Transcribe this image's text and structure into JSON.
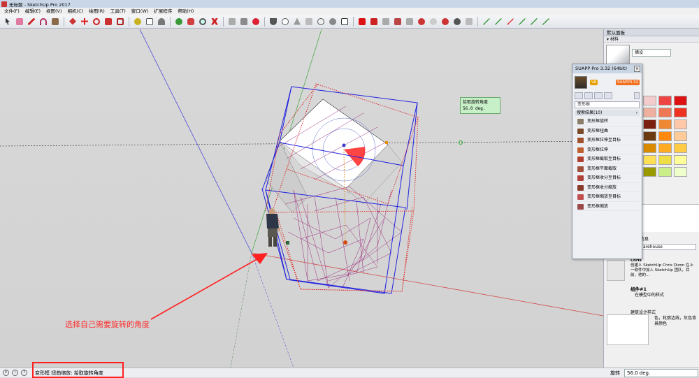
{
  "window": {
    "title": "无标题 - SketchUp Pro 2017"
  },
  "menu": [
    "文件(F)",
    "编辑(E)",
    "视图(V)",
    "相机(C)",
    "绘图(R)",
    "工具(T)",
    "窗口(W)",
    "扩展程序",
    "帮助(H)"
  ],
  "toolbar_icons": [
    "select-icon",
    "eraser-icon",
    "pencil-icon",
    "arc-icon",
    "shape-icon",
    "push-pull-icon",
    "move-icon",
    "rotate-icon",
    "scale-icon",
    "offset-icon",
    "tape-icon",
    "text-icon",
    "protractor-icon",
    "axes-icon",
    "orbit-icon",
    "pan-icon",
    "zoom-icon",
    "zoom-extents-icon",
    "warehouse-icon",
    "extension-icon",
    "sandbox-icon",
    "section-icon",
    "style-icon",
    "shadow-icon",
    "suapp-icon",
    "solid-icon",
    "component-icon",
    "layer-icon",
    "paint-icon",
    "ruby-icon",
    "teapot-icon",
    "iso-icon",
    "view-top-icon",
    "view-front-icon",
    "view-right-icon",
    "view-back-icon",
    "view-left-icon",
    "scene-icon"
  ],
  "viewport": {
    "tooltip_line1": "拾取旋转角度",
    "tooltip_line2": "56.0 deg.",
    "annotation": "选择自己需要旋转的角度"
  },
  "tray": {
    "title": "默认面板",
    "material_section": "材料",
    "material_name": "拂设",
    "info_label": "信息",
    "warehouse_label": "arehouse",
    "author": "Chris",
    "author_desc": "创建人 SketchUp Chris Dizon 在上一软件中加入 SketchUp 团队，目前，他的...",
    "component_name": "组件#1",
    "component_hint": "在模型中的样式",
    "style_label": "建筑设计样式",
    "style_desc": "色，轮廓边线，灰色背景颜色",
    "swatch_colors": [
      "#f5cccc",
      "#ee4444",
      "#dd1111",
      "#f0b0a0",
      "#ee7755",
      "#ee3322",
      "#7a1e10",
      "#ee8833",
      "#ffc8a8",
      "#6b3a10",
      "#ff8811",
      "#ffcc99",
      "#d98a00",
      "#ffaa22",
      "#ffcc44",
      "#ffe055",
      "#eedd44",
      "#ffff99",
      "#999900",
      "#ccee88",
      "#eeffcc"
    ]
  },
  "suapp": {
    "title": "SUAPP Pro 3.32 (64bit)",
    "badge_level": "V6",
    "badge_version": "SUAPP3.32",
    "search_value": "变形框",
    "results_label": "搜索结果(10)",
    "results_arrow": "›",
    "items": [
      {
        "label": "变形框旋转",
        "color": "#8a7d6a"
      },
      {
        "label": "变形框扭曲",
        "color": "#7a4a2a"
      },
      {
        "label": "变形框拉伸至目标",
        "color": "#a0522d"
      },
      {
        "label": "变形框拉伸",
        "color": "#c06030"
      },
      {
        "label": "变形框截取至目标",
        "color": "#b04030"
      },
      {
        "label": "变形框平面截取",
        "color": "#a0503a"
      },
      {
        "label": "变形框收分至目标",
        "color": "#b0403a"
      },
      {
        "label": "变形框收分缩放",
        "color": "#8a3a2a"
      },
      {
        "label": "变形框缩放至目标",
        "color": "#c05050"
      },
      {
        "label": "变形框缩放",
        "color": "#9a4a4a"
      }
    ]
  },
  "status": {
    "message": "变形框 扭曲缩放: 拾取旋转角度",
    "measure_label": "旋转",
    "measure_value": "56.0 deg."
  }
}
